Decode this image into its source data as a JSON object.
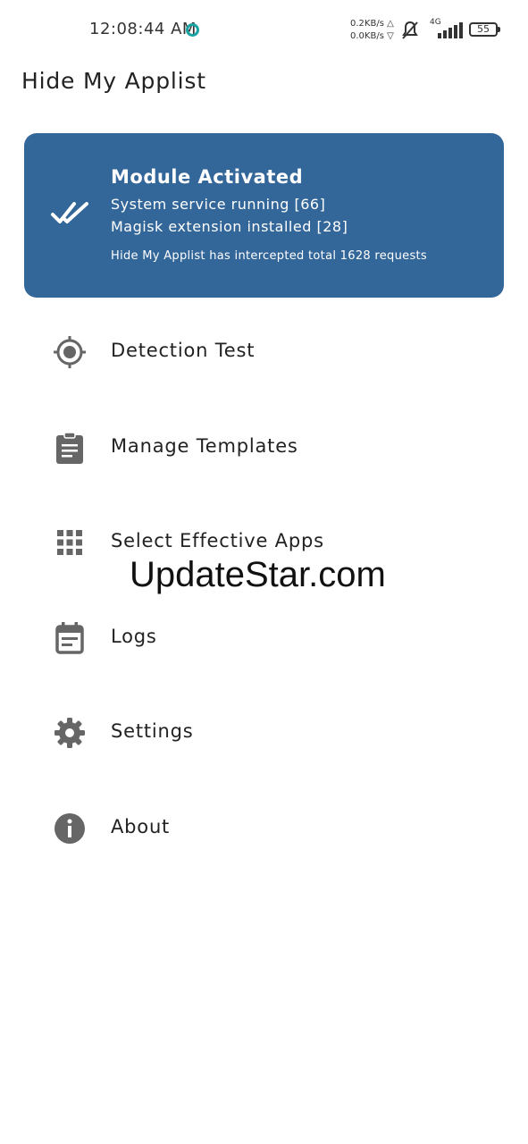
{
  "status_bar": {
    "time": "12:08:44 AM",
    "speed_up": "0.2KB/s",
    "speed_down": "0.0KB/s",
    "network": "4G",
    "battery": "55"
  },
  "app": {
    "title": "Hide My Applist"
  },
  "status_card": {
    "title": "Module Activated",
    "line1": "System service running [66]",
    "line2": "Magisk extension installed [28]",
    "line3": "Hide My Applist has intercepted total 1628 requests",
    "bg_color": "#336699"
  },
  "menu": {
    "items": [
      {
        "label": "Detection Test",
        "icon": "target-icon"
      },
      {
        "label": "Manage Templates",
        "icon": "clipboard-icon"
      },
      {
        "label": "Select Effective Apps",
        "icon": "apps-grid-icon"
      },
      {
        "label": "Logs",
        "icon": "calendar-icon"
      },
      {
        "label": "Settings",
        "icon": "gear-icon"
      },
      {
        "label": "About",
        "icon": "info-icon"
      }
    ]
  },
  "watermark": "UpdateStar.com"
}
